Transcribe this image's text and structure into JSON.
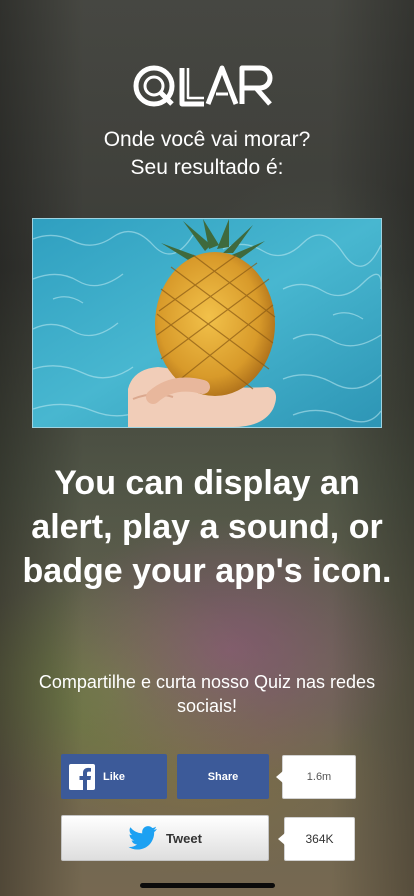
{
  "brand": {
    "logo_text": "QLAR"
  },
  "result": {
    "question": "Onde você vai morar?",
    "intro": "Seu resultado é:",
    "headline": "You can display an alert, play a sound, or badge your app's icon."
  },
  "share": {
    "prompt": "Compartilhe e curta nosso Quiz nas redes sociais!",
    "facebook": {
      "like_label": "Like",
      "share_label": "Share",
      "count": "1.6m",
      "color": "#3c5a99"
    },
    "twitter": {
      "tweet_label": "Tweet",
      "count": "364K",
      "color": "#1da1f2"
    }
  },
  "icons": {
    "facebook": "facebook-icon",
    "twitter": "twitter-bird-icon"
  }
}
